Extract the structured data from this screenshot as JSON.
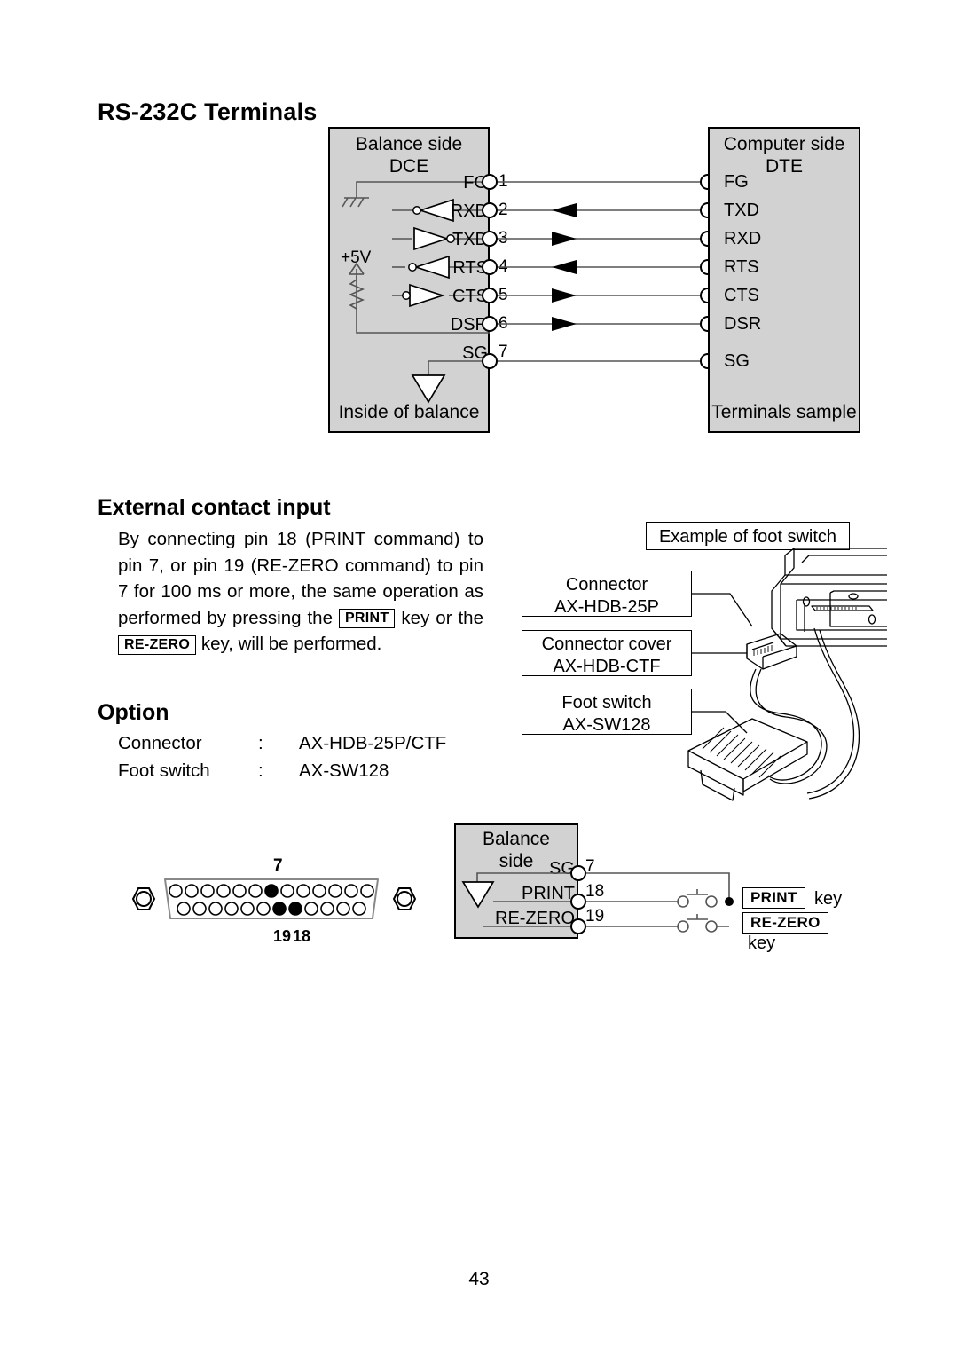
{
  "page": {
    "number": "43"
  },
  "rs232": {
    "heading": "RS-232C Terminals",
    "balance_panel": {
      "title_line1": "Balance side",
      "title_line2": "DCE",
      "footer": "Inside of balance",
      "supply_label": "+5V"
    },
    "computer_panel": {
      "title_line1": "Computer side",
      "title_line2": "DTE",
      "footer": "Terminals sample"
    },
    "lines": [
      {
        "balance_signal": "FG",
        "pin": "1",
        "direction": "none",
        "computer_signal": "FG"
      },
      {
        "balance_signal": "RXD",
        "pin": "2",
        "direction": "left",
        "computer_signal": "TXD"
      },
      {
        "balance_signal": "TXD",
        "pin": "3",
        "direction": "right",
        "computer_signal": "RXD"
      },
      {
        "balance_signal": "RTS",
        "pin": "4",
        "direction": "left",
        "computer_signal": "RTS"
      },
      {
        "balance_signal": "CTS",
        "pin": "5",
        "direction": "right",
        "computer_signal": "CTS"
      },
      {
        "balance_signal": "DSR",
        "pin": "6",
        "direction": "right",
        "computer_signal": "DSR"
      },
      {
        "balance_signal": "SG",
        "pin": "7",
        "direction": "none",
        "computer_signal": "SG"
      }
    ]
  },
  "external_contact": {
    "heading": "External contact input",
    "paragraph_part1": "By connecting pin 18 (PRINT command) to pin 7, or pin 19 (RE-ZERO command) to pin 7 for 100 ms or more, the same operation as performed by pressing the",
    "key1": "PRINT",
    "paragraph_part2": "key or the",
    "key2": "RE-ZERO",
    "paragraph_part3": "key, will be performed."
  },
  "option": {
    "heading": "Option",
    "rows": [
      {
        "label": "Connector",
        "sep": ":",
        "value": "AX-HDB-25P/CTF"
      },
      {
        "label": "Foot switch",
        "sep": ":",
        "value": "AX-SW128"
      }
    ]
  },
  "footswitch_figure": {
    "title": "Example of foot switch",
    "callouts": [
      {
        "line1": "Connector",
        "line2": "AX-HDB-25P"
      },
      {
        "line1": "Connector cover",
        "line2": "AX-HDB-CTF"
      },
      {
        "line1": "Foot switch",
        "line2": "AX-SW128"
      }
    ]
  },
  "connector_pinout": {
    "top_row_pins": 13,
    "bottom_row_pins": 12,
    "top_highlight_index": 7,
    "bottom_highlight_indices": [
      7,
      8
    ],
    "label_top": "7",
    "label_bottom_left": "19",
    "label_bottom_right": "18"
  },
  "contact_diagram": {
    "panel_title_line1": "Balance",
    "panel_title_line2": "side",
    "rows": [
      {
        "signal": "SG",
        "pin": "7",
        "key": "",
        "key_suffix": ""
      },
      {
        "signal": "PRINT",
        "pin": "18",
        "key": "PRINT",
        "key_suffix": "key"
      },
      {
        "signal": "RE-ZERO",
        "pin": "19",
        "key": "RE-ZERO",
        "key_suffix": "key"
      }
    ]
  },
  "colors": {
    "panel_fill": "#d2d2d2",
    "line": "#000000"
  }
}
